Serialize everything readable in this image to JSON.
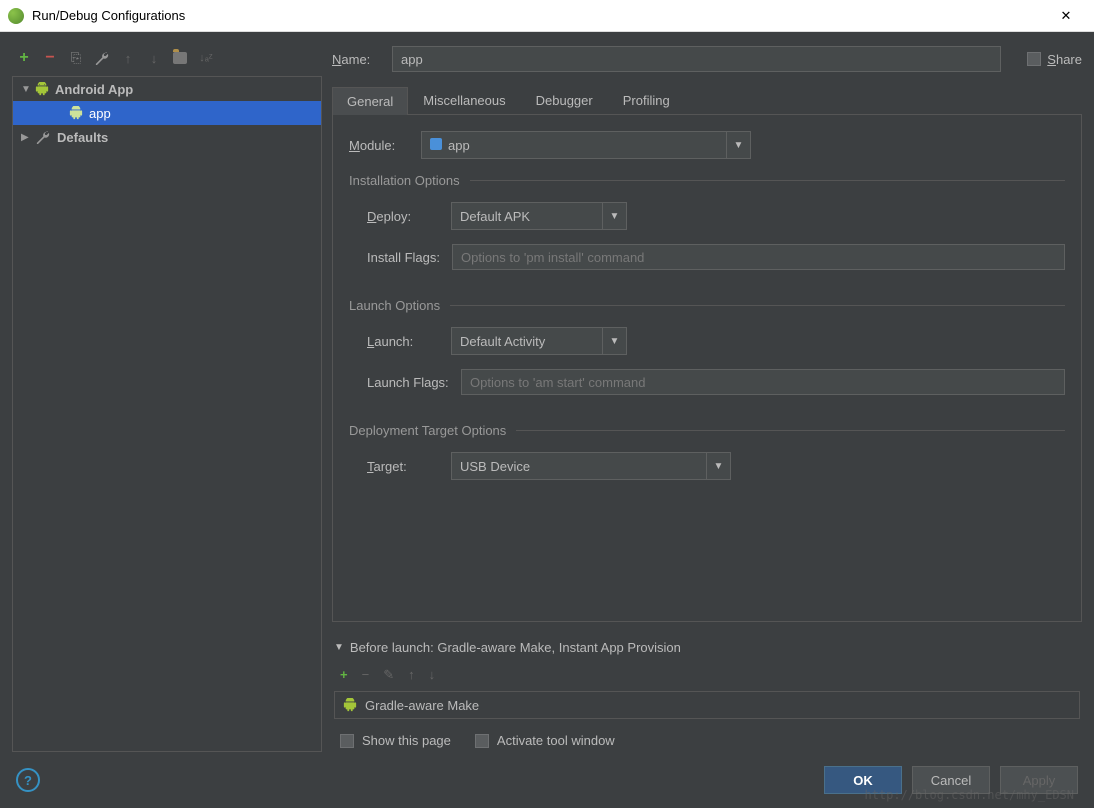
{
  "window": {
    "title": "Run/Debug Configurations"
  },
  "toolbar": {
    "add": "+",
    "remove": "−",
    "copy": "⎘",
    "edit": "✎",
    "up": "↑",
    "down": "↓",
    "folder": "",
    "sort": "↓ₐᶻ"
  },
  "tree": {
    "group": "Android App",
    "group_item": "app",
    "defaults": "Defaults"
  },
  "form": {
    "name_label": "Name:",
    "name_value": "app",
    "share_label": "Share"
  },
  "tabs": [
    "General",
    "Miscellaneous",
    "Debugger",
    "Profiling"
  ],
  "general": {
    "module_label": "Module:",
    "module_value": "app",
    "installation_legend": "Installation Options",
    "deploy_label": "Deploy:",
    "deploy_value": "Default APK",
    "install_flags_label": "Install Flags:",
    "install_flags_placeholder": "Options to 'pm install' command",
    "launch_legend": "Launch Options",
    "launch_label": "Launch:",
    "launch_value": "Default Activity",
    "launch_flags_label": "Launch Flags:",
    "launch_flags_placeholder": "Options to 'am start' command",
    "deployment_legend": "Deployment Target Options",
    "target_label": "Target:",
    "target_value": "USB Device"
  },
  "before_launch": {
    "title": "Before launch: Gradle-aware Make, Instant App Provision",
    "item": "Gradle-aware Make",
    "show_page": "Show this page",
    "activate_window": "Activate tool window"
  },
  "footer": {
    "ok": "OK",
    "cancel": "Cancel",
    "apply": "Apply"
  },
  "watermark": "http://blog.csdn.net/mhy_EDSN"
}
